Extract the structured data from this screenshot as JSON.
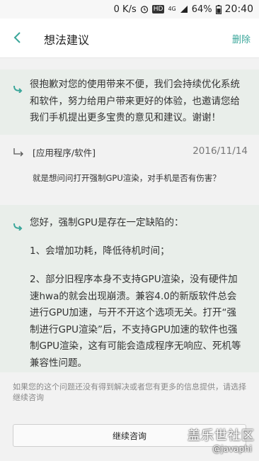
{
  "status_bar": {
    "net_speed": "0 K/s",
    "hd": "HD",
    "net_type": "4G",
    "battery": "64%",
    "time": "20:40"
  },
  "header": {
    "title": "想法建议",
    "delete_label": "删除",
    "accent_color": "#3aa69a"
  },
  "reply_1": {
    "text": "很抱歉对您的使用带来不便，我们会持续优化系统和软件，努力给用户带来更好的体验，也邀请您给我们手机提出更多宝贵的意见和建议。谢谢！"
  },
  "question": {
    "category": "[应用程序/软件]",
    "date": "2016/11/14",
    "body": "就是想问问打开强制GPU渲染，对手机是否有伤害？"
  },
  "reply_2": {
    "p1": "您好，强制GPU是存在一定缺陷的：",
    "p2": "1、会增加功耗，降低待机时间；",
    "p3": "2、部分旧程序本身不支持GPU渲染，没有硬件加速hwa的就会出现崩溃。兼容4.0的新版软件总会进行GPU加速，与开不开这个选项无关。打开“强制进行GPU渲染”后，不支持GPU加速的软件也强制GPU渲染，这有可能会造成程序无响应、死机等兼容性问题。"
  },
  "footer": {
    "hint": "如果您的这个问题还没有得到解决或者您有更多的信息提供，请选择继续咨询",
    "continue_label": "继续咨询"
  },
  "watermark": {
    "logo": "盖乐世社区",
    "user": "@javaphi"
  }
}
